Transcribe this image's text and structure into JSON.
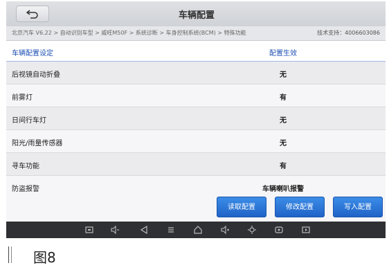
{
  "titlebar": {
    "title": "车辆配置"
  },
  "breadcrumb": {
    "path": "北京汽车 V6.22 > 自动识别车型 > 威旺M50F > 系统诊断 > 车身控制系统(BCM) > 特殊功能",
    "support": "技术支持：4006603086"
  },
  "table": {
    "headers": {
      "name": "车辆配置设定",
      "value": "配置生效"
    },
    "rows": [
      {
        "name": "后视镜自动折叠",
        "value": "无"
      },
      {
        "name": "前雾灯",
        "value": "有"
      },
      {
        "name": "日间行车灯",
        "value": "无"
      },
      {
        "name": "阳光/雨量传感器",
        "value": "无"
      },
      {
        "name": "寻车功能",
        "value": "有"
      },
      {
        "name": "防盗报警",
        "value": "车辆喇叭报警"
      }
    ]
  },
  "actions": {
    "read_label": "读取配置",
    "modify_label": "修改配置",
    "write_label": "写入配置",
    "accent": "#1f63c7"
  },
  "navbar": {
    "icons": [
      "screenshot-icon",
      "volume-down-icon",
      "back-nav-icon",
      "menu-icon",
      "home-icon",
      "volume-up-icon",
      "settings-icon",
      "vci-icon",
      "recent-icon"
    ]
  },
  "caption": {
    "text": "图8"
  }
}
